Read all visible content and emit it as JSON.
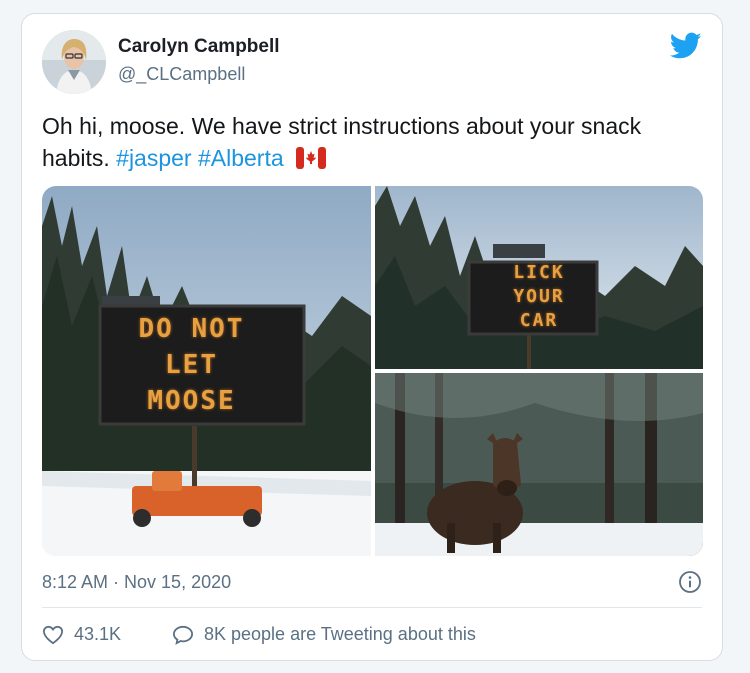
{
  "author": {
    "name": "Carolyn Campbell",
    "handle": "@_CLCampbell"
  },
  "tweet": {
    "text": "Oh hi, moose. We have strict instructions about your snack habits.",
    "hashtags": [
      "#jasper",
      "#Alberta"
    ]
  },
  "media": {
    "sign1": [
      "DO NOT",
      "LET",
      "MOOSE"
    ],
    "sign2": [
      "LICK",
      "YOUR",
      "CAR"
    ]
  },
  "timestamp": "8:12 AM · Nov 15, 2020",
  "actions": {
    "likes": "43.1K",
    "replies_label": "8K people are Tweeting about this"
  },
  "colors": {
    "link": "#1b95e0",
    "bird": "#1da1f2",
    "meta": "#5b7083"
  },
  "icons": [
    "twitter-bird-icon",
    "canada-flag-icon",
    "info-icon",
    "heart-icon",
    "speech-bubble-icon"
  ]
}
